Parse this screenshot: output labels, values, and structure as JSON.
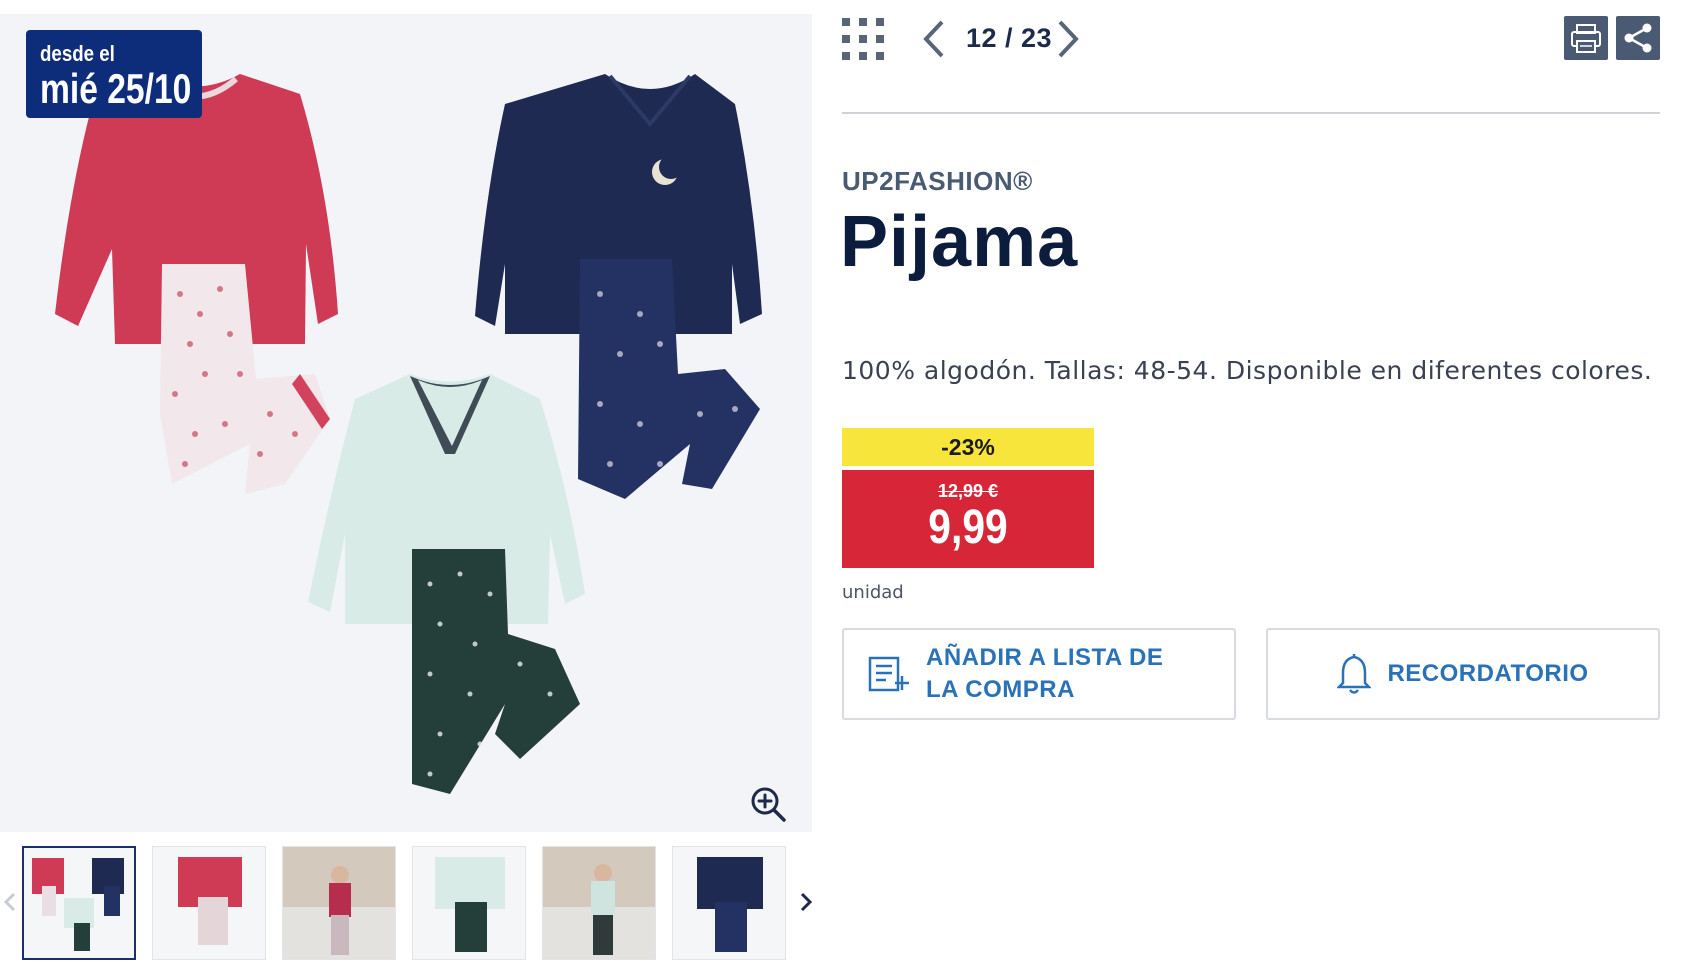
{
  "gallery": {
    "badge": {
      "line1": "desde el",
      "line2": "mié 25/10"
    },
    "zoom_icon": "zoom-in-icon",
    "thumbnails": [
      {
        "name": "thumb-all-pajamas",
        "active": true
      },
      {
        "name": "thumb-red-pajama",
        "active": false
      },
      {
        "name": "thumb-model-red",
        "active": false
      },
      {
        "name": "thumb-mint-pajama",
        "active": false
      },
      {
        "name": "thumb-model-mint",
        "active": false
      },
      {
        "name": "thumb-navy-pajama",
        "active": false
      }
    ]
  },
  "nav": {
    "counter": "12 / 23",
    "grid_icon": "grid-icon",
    "prev_icon": "chevron-left-icon",
    "next_icon": "chevron-right-icon",
    "print_icon": "print-icon",
    "share_icon": "share-icon"
  },
  "product": {
    "brand": "UP2FASHION®",
    "title": "Pijama",
    "description": "100% algodón. Tallas: 48-54. Disponible en diferentes colores.",
    "discount": "-23%",
    "old_price": "12,99 €",
    "price": "9,99",
    "unit": "unidad"
  },
  "actions": {
    "add_to_list": "AÑADIR A LISTA DE LA COMPRA",
    "reminder": "RECORDATORIO"
  },
  "colors": {
    "badge_bg": "#0d2c7a",
    "discount_bg": "#f8e53c",
    "price_bg": "#d72638",
    "action_text": "#2a72b8",
    "title": "#0b1c3d"
  }
}
